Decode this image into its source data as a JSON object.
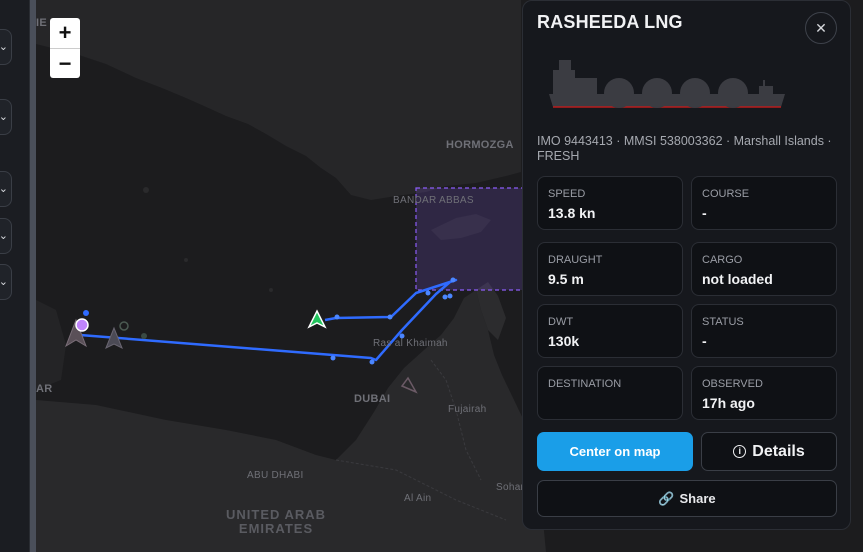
{
  "map": {
    "zoom_in_label": "+",
    "zoom_out_label": "−",
    "labels": {
      "hormozgan": "HORMOZGA",
      "bandar_abbas": "BANDAR ABBAS",
      "ras_al_khaimah": "Ras al Khaimah",
      "dubai": "DUBAI",
      "fujairah": "Fujairah",
      "abu_dhabi": "ABU DHABI",
      "al_ain": "Al Ain",
      "sohar": "Sohar",
      "uae_line1": "UNITED ARAB",
      "uae_line2": "EMIRATES",
      "edge_ar": "AR",
      "edge_ie": "IE"
    },
    "colors": {
      "track": "#2f6bff",
      "selection_box": "#8b5cf6",
      "vessel_marker": "#22c55e"
    }
  },
  "vessel": {
    "name": "RASHEEDA LNG",
    "close_label": "✕",
    "meta": "IMO 9443413 · MMSI 538003362 · Marshall Islands · FRESH",
    "fields": [
      {
        "label": "SPEED",
        "value": "13.8 kn"
      },
      {
        "label": "COURSE",
        "value": "-"
      },
      {
        "label": "DRAUGHT",
        "value": "9.5 m"
      },
      {
        "label": "CARGO",
        "value": "not loaded"
      },
      {
        "label": "DWT",
        "value": "130k"
      },
      {
        "label": "STATUS",
        "value": "-"
      },
      {
        "label": "DESTINATION",
        "value": ""
      },
      {
        "label": "OBSERVED",
        "value": "17h ago"
      }
    ],
    "actions": {
      "center": "Center on map",
      "details": "Details",
      "share": "Share"
    }
  }
}
